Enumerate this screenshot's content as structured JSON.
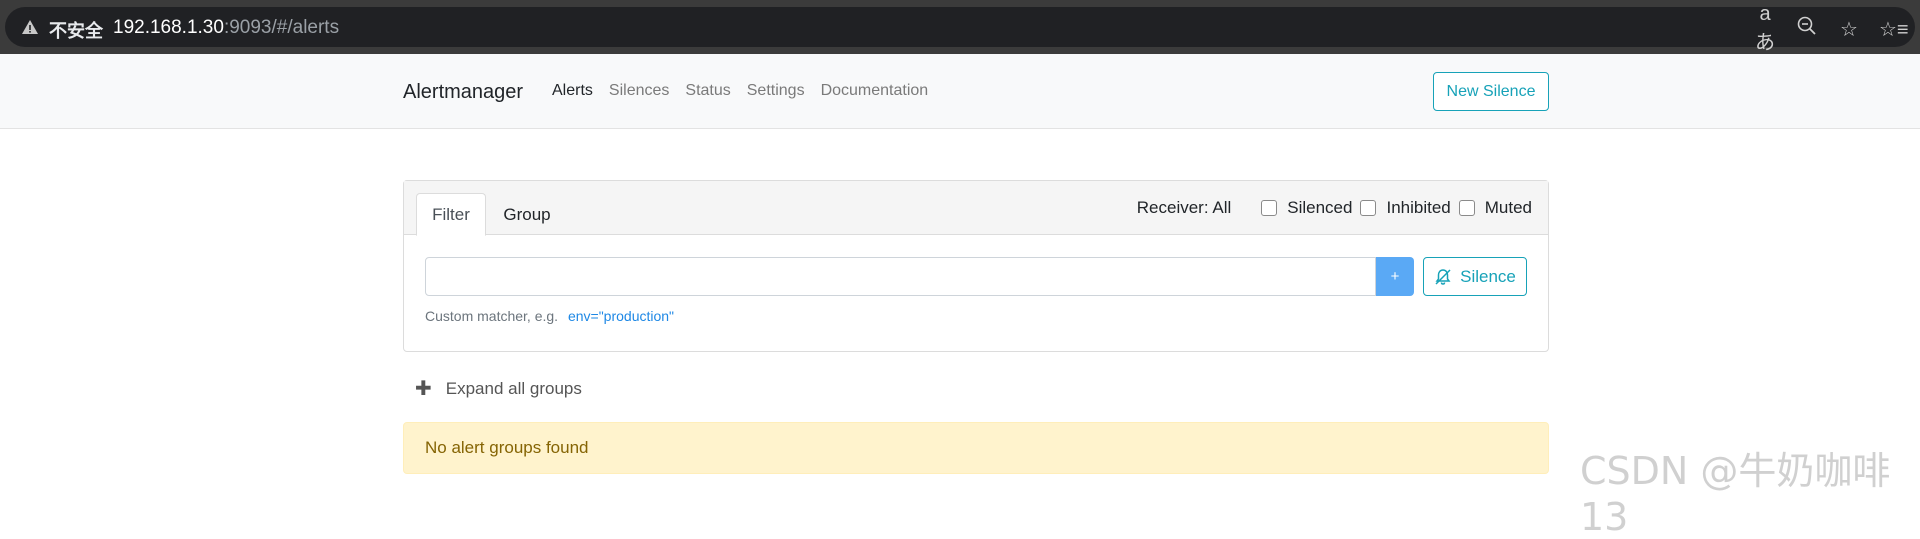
{
  "browser": {
    "security_label": "不安全",
    "url_host": "192.168.1.30",
    "url_rest": ":9093/#/alerts"
  },
  "nav": {
    "brand": "Alertmanager",
    "links": [
      "Alerts",
      "Silences",
      "Status",
      "Settings",
      "Documentation"
    ],
    "new_silence": "New Silence"
  },
  "filter_card": {
    "tabs": [
      "Filter",
      "Group"
    ],
    "receiver": "Receiver: All",
    "checkboxes": [
      "Silenced",
      "Inhibited",
      "Muted"
    ],
    "input_value": "",
    "add_button": "+",
    "silence_button": "Silence",
    "hint_label": "Custom matcher, e.g.",
    "hint_example": "env=\"production\""
  },
  "expand_label": "Expand all groups",
  "alert_message": "No alert groups found",
  "watermark": "CSDN @牛奶咖啡13",
  "colors": {
    "accent": "#17a2b8",
    "primary": "#5aa9f5",
    "warning_bg": "#fff3cd",
    "warning_text": "#856404"
  }
}
